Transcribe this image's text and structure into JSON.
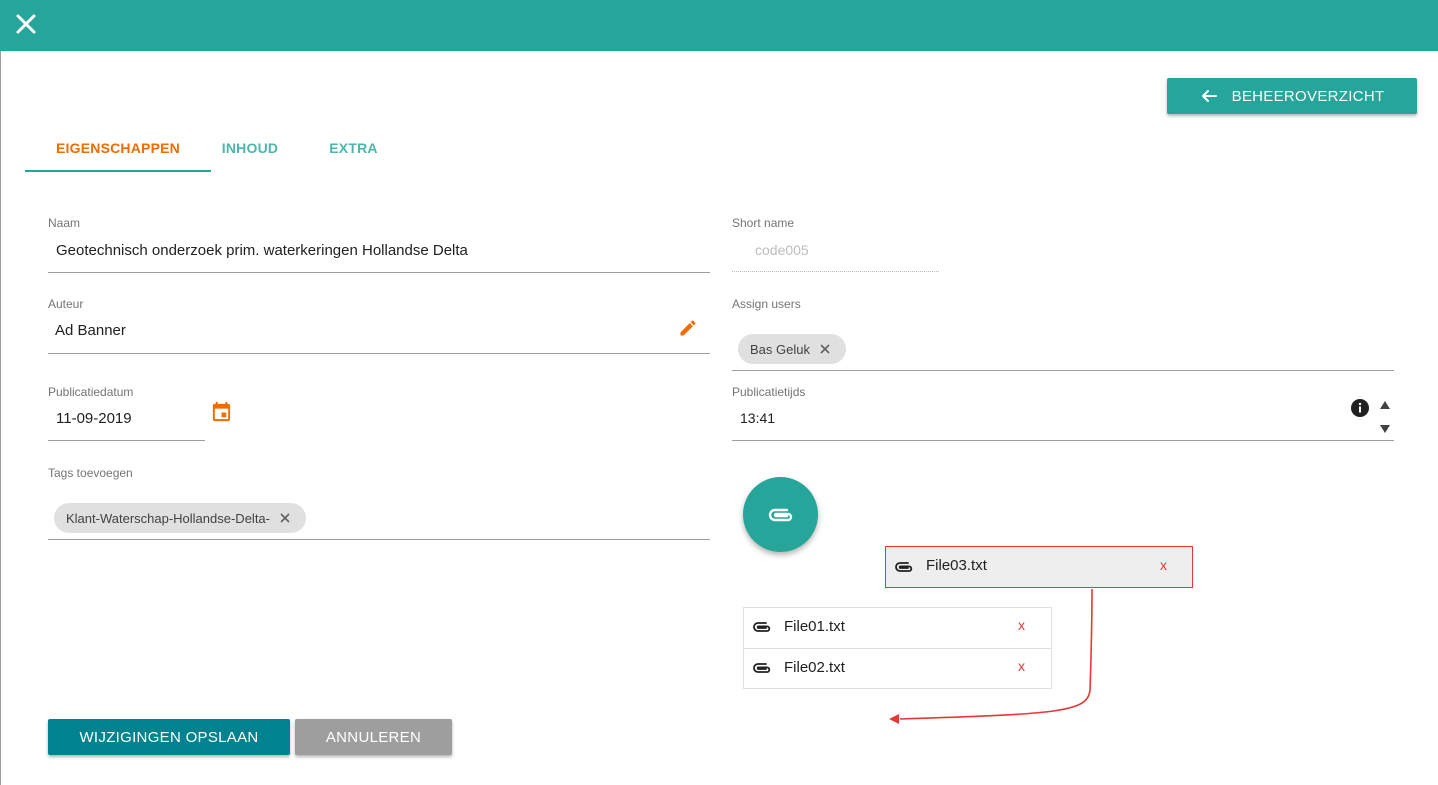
{
  "topbar": {
    "color": "#26a69a",
    "close_icon": "close-icon"
  },
  "header": {
    "back_button_label": "BEHEEROVERZICHT",
    "back_icon": "arrow-left-icon"
  },
  "tabs": [
    {
      "label": "EIGENSCHAPPEN",
      "active": true
    },
    {
      "label": "INHOUD",
      "active": false
    },
    {
      "label": "EXTRA",
      "active": false
    }
  ],
  "form": {
    "naam": {
      "label": "Naam",
      "value": "Geotechnisch onderzoek prim. waterkeringen Hollandse Delta"
    },
    "short_name": {
      "label": "Short name",
      "value": "code005"
    },
    "auteur": {
      "label": "Auteur",
      "value": "Ad Banner",
      "icon": "pencil-icon"
    },
    "assign_users": {
      "label": "Assign users",
      "chips": [
        "Bas Geluk"
      ]
    },
    "publicatiedatum": {
      "label": "Publicatiedatum",
      "value": "11-09-2019",
      "icon": "calendar-icon"
    },
    "publicatietijds": {
      "label": "Publicatietijds",
      "value": "13:41",
      "icon": "info-icon"
    },
    "tags": {
      "label": "Tags toevoegen",
      "chips": [
        "Klant-Waterschap-Hollandse-Delta-"
      ]
    }
  },
  "attachments": {
    "fab_icon": "paperclip-icon",
    "dragging_file": {
      "name": "File03.txt",
      "remove": "x"
    },
    "files": [
      {
        "name": "File01.txt",
        "remove": "x"
      },
      {
        "name": "File02.txt",
        "remove": "x"
      }
    ]
  },
  "actions": {
    "save_label": "WIJZIGINGEN OPSLAAN",
    "cancel_label": "ANNULEREN"
  },
  "colors": {
    "accent": "#26a69a",
    "active_tab": "#ef6c00",
    "save": "#00838f",
    "cancel": "#9e9e9e",
    "remove": "#e53935"
  }
}
